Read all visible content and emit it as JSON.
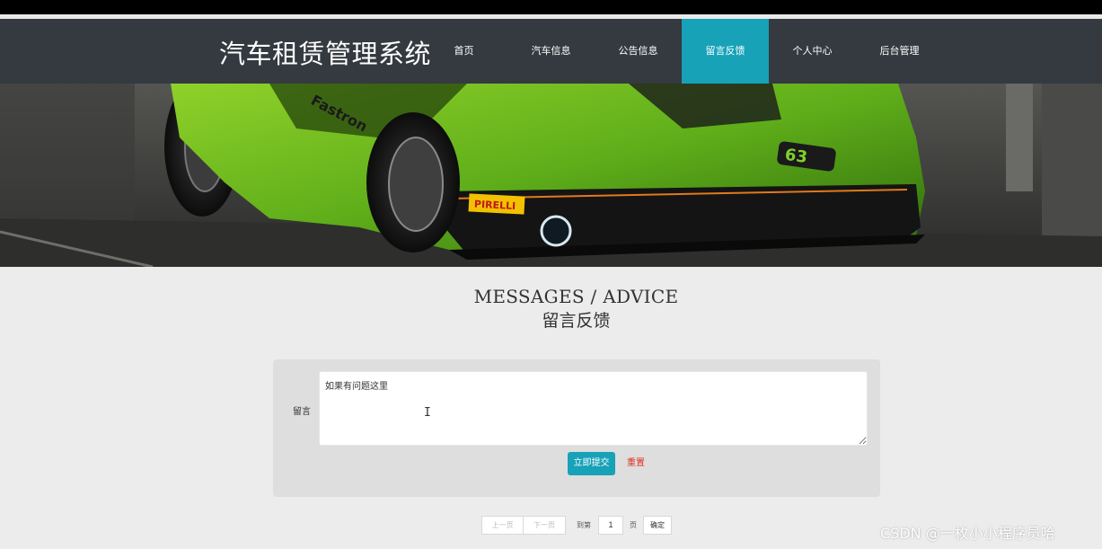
{
  "site": {
    "title": "汽车租赁管理系统"
  },
  "nav": {
    "items": [
      {
        "label": "首页"
      },
      {
        "label": "汽车信息"
      },
      {
        "label": "公告信息"
      },
      {
        "label": "留言反馈"
      },
      {
        "label": "个人中心"
      },
      {
        "label": "后台管理"
      }
    ],
    "active_index": 3
  },
  "banner": {
    "logo_text": "Fastron",
    "sponsor_text": "PIRELLI",
    "badge_text": "63"
  },
  "section": {
    "heading_en": "MESSAGES / ADVICE",
    "heading_cn": "留言反馈"
  },
  "form": {
    "label": "留言",
    "message_value": "如果有问题这里",
    "submit_label": "立即提交",
    "reset_label": "重置"
  },
  "pagination": {
    "prev_label": "上一页",
    "next_label": "下一页",
    "goto_label": "到第",
    "page_value": "1",
    "page_unit": "页",
    "confirm_label": "确定"
  },
  "watermark": "CSDN @一枚小小程序员哈",
  "colors": {
    "navbar": "#343a40",
    "accent": "#17a2b8",
    "reset": "#e0301e",
    "background": "#ececec"
  }
}
